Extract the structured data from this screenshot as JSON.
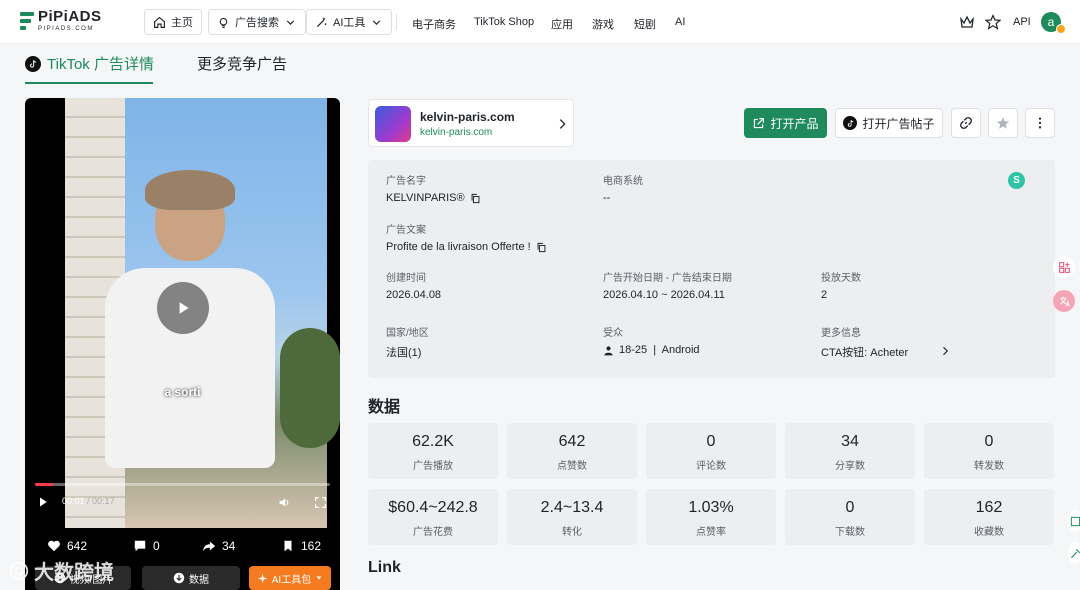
{
  "brand": {
    "name": "PiPiADS",
    "sub": "PIPIADS.COM"
  },
  "nav": {
    "home": "主页",
    "ad_search": "广告搜索",
    "ai_tools": "AI工具",
    "links": [
      "电子商务",
      "TikTok Shop",
      "应用",
      "游戏",
      "短剧",
      "AI"
    ],
    "api": "API",
    "avatar_letter": "a"
  },
  "tabs": {
    "detail": "TikTok 广告详情",
    "more": "更多竞争广告"
  },
  "video": {
    "caption": "a sorti",
    "time_current": "00:01",
    "time_total": "00:17",
    "progress_fraction": 0.06,
    "likes": "642",
    "comments": "0",
    "shares": "34",
    "saves": "162",
    "btn_video": "视频/图片",
    "btn_data": "数据",
    "btn_ai": "AI工具包"
  },
  "advertiser": {
    "name": "kelvin-paris.com",
    "url": "kelvin-paris.com"
  },
  "actions": {
    "open_product": "打开产品",
    "open_post": "打开广告帖子"
  },
  "info": {
    "ad_name_label": "广告名字",
    "ad_name": "KELVINPARIS®",
    "ecom_label": "电商系统",
    "ecom": "--",
    "ecom_badge": "S",
    "copy_label": "广告文案",
    "copy": "Profite de la livraison Offerte !",
    "created_label": "创建时间",
    "created": "2026.04.08",
    "period_label": "广告开始日期 - 广告结束日期",
    "period": "2026.04.10 ~ 2026.04.11",
    "days_label": "投放天数",
    "days": "2",
    "country_label": "国家/地区",
    "country": "法国(1)",
    "audience_label": "受众",
    "audience": "18-25  |  Android",
    "more_label": "更多信息",
    "more": "CTA按钮: Acheter"
  },
  "data_section": {
    "title": "数据",
    "cards": [
      {
        "num": "62.2K",
        "cap": "广告播放"
      },
      {
        "num": "642",
        "cap": "点赞数"
      },
      {
        "num": "0",
        "cap": "评论数"
      },
      {
        "num": "34",
        "cap": "分享数"
      },
      {
        "num": "0",
        "cap": "转发数"
      },
      {
        "num": "$60.4~242.8",
        "cap": "广告花费"
      },
      {
        "num": "2.4~13.4",
        "cap": "转化"
      },
      {
        "num": "1.03%",
        "cap": "点赞率"
      },
      {
        "num": "0",
        "cap": "下载数"
      },
      {
        "num": "162",
        "cap": "收藏数"
      }
    ]
  },
  "link_section": {
    "title": "Link"
  },
  "watermark": "大数跨境",
  "colors": {
    "brand_green": "#1f8a5c",
    "progress_red": "#ff3b4a",
    "ai_orange": "#f47b20"
  }
}
